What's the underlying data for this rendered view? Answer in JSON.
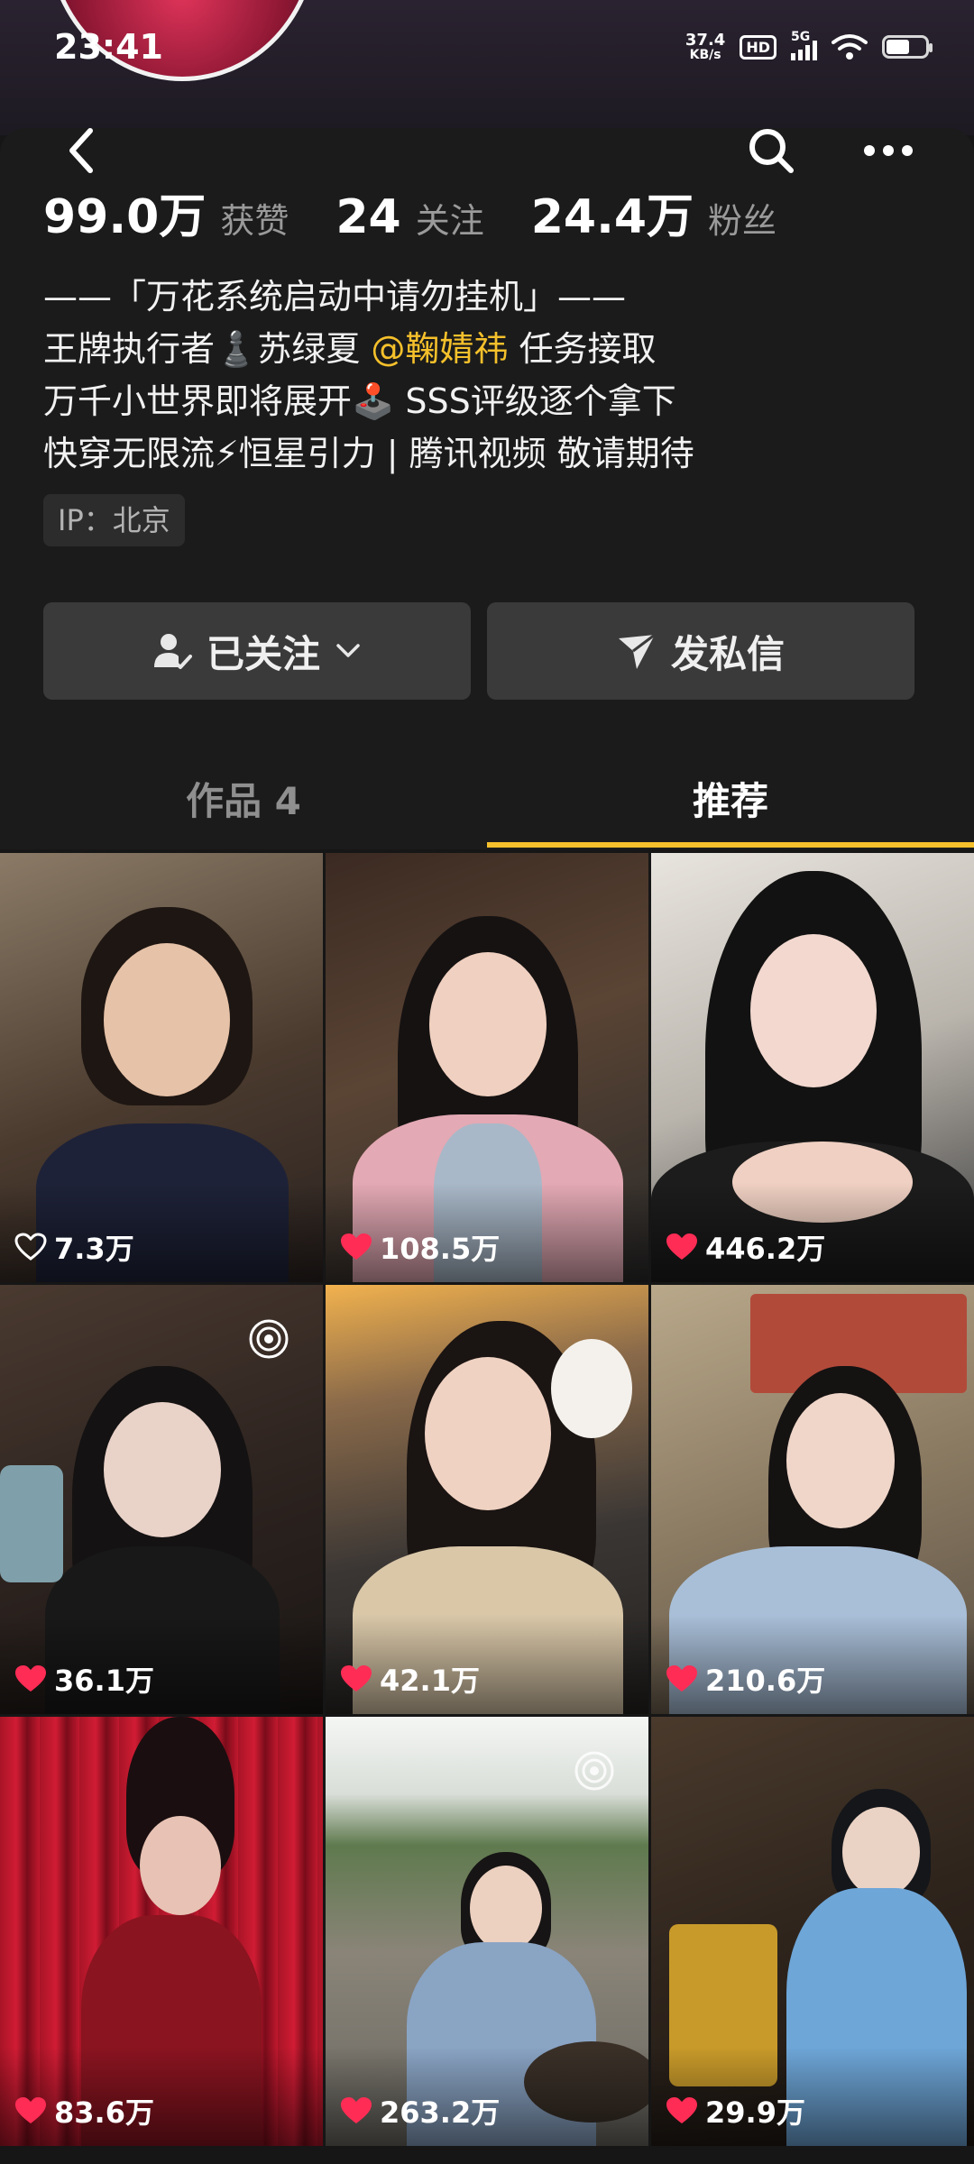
{
  "status_bar": {
    "time": "23:41",
    "speed_value": "37.4",
    "speed_unit": "KB/s",
    "hd_badge": "HD",
    "network": "5G",
    "battery_level": 0.55
  },
  "header": {
    "back_icon": "back-arrow-icon",
    "search_icon": "search-icon",
    "more_icon": "more-dots-icon"
  },
  "stats": [
    {
      "value": "99.0万",
      "label": "获赞"
    },
    {
      "value": "24",
      "label": "关注"
    },
    {
      "value": "24.4万",
      "label": "粉丝"
    }
  ],
  "bio": {
    "line1": "——「万花系统启动中请勿挂机」——",
    "line2_pre": "王牌执行者♟️苏绿夏 ",
    "line2_mention": "@鞠婧祎",
    "line2_post": " 任务接取",
    "line3": "万千小世界即将展开🕹️ SSS评级逐个拿下",
    "line4": "快穿无限流⚡恒星引力 | 腾讯视频 敬请期待"
  },
  "ip_tag": "IP：北京",
  "actions": {
    "follow_label": "已关注",
    "message_label": "发私信"
  },
  "tabs": {
    "works": "作品 4",
    "recommend": "推荐"
  },
  "videos": [
    {
      "likes": "7.3万",
      "liked": false
    },
    {
      "likes": "108.5万",
      "liked": true
    },
    {
      "likes": "446.2万",
      "liked": true
    },
    {
      "likes": "36.1万",
      "liked": true
    },
    {
      "likes": "42.1万",
      "liked": true
    },
    {
      "likes": "210.6万",
      "liked": true
    },
    {
      "likes": "83.6万",
      "liked": true
    },
    {
      "likes": "263.2万",
      "liked": true
    },
    {
      "likes": "29.9万",
      "liked": true
    }
  ],
  "colors": {
    "accent": "#f5c02b",
    "like": "#ff2c55",
    "background": "#161616"
  }
}
